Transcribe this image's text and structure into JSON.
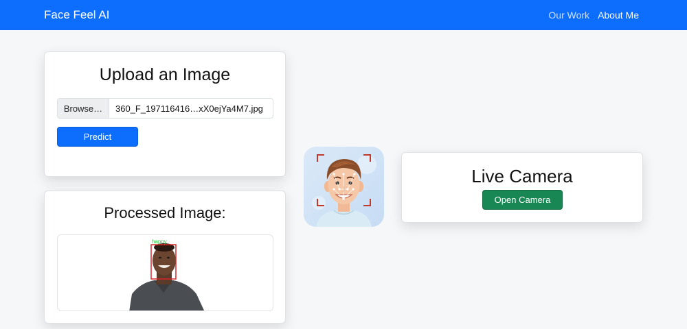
{
  "navbar": {
    "brand": "Face Feel AI",
    "links": [
      {
        "label": "Our Work"
      },
      {
        "label": "About Me"
      }
    ],
    "background": "#0d6efd"
  },
  "upload": {
    "title": "Upload an Image",
    "browse_label": "Browse…",
    "file_name": "360_F_197116416…xX0ejYa4M7.jpg",
    "predict_label": "Predict"
  },
  "processed": {
    "title": "Processed Image:",
    "emotion_label": "happy"
  },
  "camera": {
    "title": "Live Camera",
    "open_label": "Open Camera"
  },
  "colors": {
    "primary": "#0d6efd",
    "success": "#198754",
    "detection_box": "#d62828",
    "emotion_text": "#27c93f"
  }
}
